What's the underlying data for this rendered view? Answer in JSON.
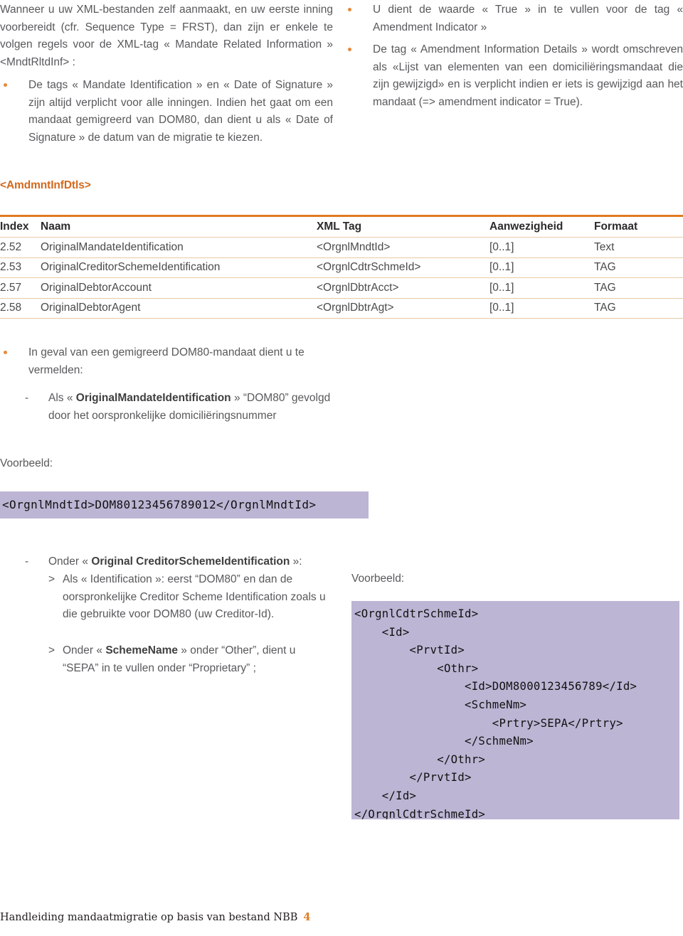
{
  "document": {
    "language": "nl",
    "accent_color": "#e07b20",
    "body_text_color": "#58595b",
    "code_background": "#bdb5d4"
  },
  "intro": {
    "paragraph": "Wanneer u uw XML-bestanden zelf aanmaakt, en uw eerste inning voorbereidt (cfr. Sequence Type = FRST), dan zijn er enkele te volgen regels voor de XML-tag « Mandate Related Information » <MndtRltdInf> :"
  },
  "bullets": {
    "left_1": "De tags « Mandate Identification » en « Date of Signature » zijn altijd verplicht voor alle inningen. Indien het gaat om een mandaat gemigreerd van DOM80, dan dient u als « Date of Signature » de datum van de migratie te kiezen.",
    "right_1": "U dient de waarde « True » in te vullen voor de tag « Amendment Indicator »",
    "right_2": "De tag « Amendment Information Details » wordt omschreven als «Lijst van elementen van een domiciliëringsmandaat die zijn gewijzigd» en is verplicht indien er iets is gewijzigd aan het mandaat (=> amendment indicator = True).",
    "left_2": "In geval van een gemigreerd DOM80-mandaat dient u te vermelden:"
  },
  "section_heading": "<AmdmntInfDtls>",
  "table": {
    "columns": [
      "Index",
      "Naam",
      "XML Tag",
      "Aanwezigheid",
      "Formaat"
    ],
    "rows": [
      {
        "index": "2.52",
        "naam": "OriginalMandateIdentification",
        "xml_tag": "<OrgnlMndtId>",
        "aanwezigheid": "[0..1]",
        "formaat": "Text"
      },
      {
        "index": "2.53",
        "naam": "OriginalCreditorSchemeIdentification",
        "xml_tag": "<OrgnlCdtrSchmeId>",
        "aanwezigheid": "[0..1]",
        "formaat": "TAG"
      },
      {
        "index": "2.57",
        "naam": "OriginalDebtorAccount",
        "xml_tag": "<OrgnlDbtrAcct>",
        "aanwezigheid": "[0..1]",
        "formaat": "TAG"
      },
      {
        "index": "2.58",
        "naam": "OriginalDebtorAgent",
        "xml_tag": "<OrgnlDbtrAgt>",
        "aanwezigheid": "[0..1]",
        "formaat": "TAG"
      }
    ]
  },
  "sub_items": {
    "dash_1": {
      "marker": "-",
      "text_prefix": "Als « ",
      "text_bold": "OriginalMandateIdentification",
      "text_suffix": " »\n“DOM80” gevolgd door het oorspronkelijke domiciliëringsnummer"
    },
    "dash_2": {
      "marker": "-",
      "text_prefix": "Onder « ",
      "text_bold": "Original CreditorSchemeIdentification",
      "text_suffix": " »:"
    },
    "gt_1": {
      "marker": ">",
      "text": "Als « Identification »: eerst “DOM80” en dan de oorspronkelijke Creditor Scheme Identification zoals u die gebruikte voor DOM80 (uw Creditor-Id)."
    },
    "gt_2": {
      "marker": ">",
      "text_prefix": "Onder « ",
      "text_bold": "SchemeName",
      "text_suffix": " » onder “Other”, dient u “SEPA” in te vullen onder “Proprietary” ;"
    }
  },
  "examples": {
    "label_left": "Voorbeeld:",
    "label_right": "Voorbeeld:",
    "code_left": "<OrgnlMndtId>DOM80123456789012</OrgnlMndtId>",
    "code_right": "<OrgnlCdtrSchmeId>\n    <Id>\n        <PrvtId>\n            <Othr>\n                <Id>DOM8000123456789</Id>\n                <SchmeNm>\n                    <Prtry>SEPA</Prtry>\n                </SchmeNm>\n            </Othr>\n        </PrvtId>\n    </Id>\n</OrgnlCdtrSchmeId>"
  },
  "footer": {
    "title": "Handleiding mandaatmigratie op basis van bestand NBB",
    "page_number": "4"
  }
}
